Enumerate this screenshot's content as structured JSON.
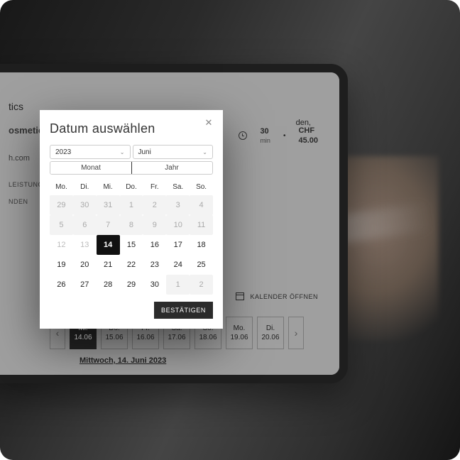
{
  "background": {
    "scene_hint": "haircut-scissors"
  },
  "screen": {
    "brand_suffix": "tics",
    "shop_name": "osmetics",
    "domain_fragment": "h.com",
    "nav": {
      "services": "LEISTUNGSAUS",
      "send": "NDEN"
    },
    "service_suffix": "den,",
    "duration": {
      "value": "30",
      "unit": "min"
    },
    "price": {
      "currency": "CHF",
      "amount": "45.00"
    },
    "calendar_link": "KALENDER ÖFFNEN",
    "strip": {
      "items": [
        {
          "dow": "Mi.",
          "date": "14.06",
          "active": true
        },
        {
          "dow": "Do.",
          "date": "15.06",
          "active": false
        },
        {
          "dow": "Fr.",
          "date": "16.06",
          "active": false
        },
        {
          "dow": "Sa.",
          "date": "17.06",
          "active": false
        },
        {
          "dow": "So.",
          "date": "18.06",
          "active": false
        },
        {
          "dow": "Mo.",
          "date": "19.06",
          "active": false
        },
        {
          "dow": "Di.",
          "date": "20.06",
          "active": false
        }
      ]
    },
    "selected_date_long": "Mittwoch, 14. Juni 2023"
  },
  "modal": {
    "title": "Datum auswählen",
    "year": "2023",
    "month": "Juni",
    "toggle": {
      "month": "Monat",
      "year": "Jahr",
      "active": "month"
    },
    "weekdays": [
      "Mo.",
      "Di.",
      "Mi.",
      "Do.",
      "Fr.",
      "Sa.",
      "So."
    ],
    "rows": [
      {
        "cells": [
          "29",
          "30",
          "31",
          "1",
          "2",
          "3",
          "4"
        ],
        "muted_until": 3,
        "all_disabled": true
      },
      {
        "cells": [
          "5",
          "6",
          "7",
          "8",
          "9",
          "10",
          "11"
        ],
        "all_disabled": true
      },
      {
        "cells": [
          "12",
          "13",
          "14",
          "15",
          "16",
          "17",
          "18"
        ],
        "past_until": 2,
        "selected_index": 2
      },
      {
        "cells": [
          "19",
          "20",
          "21",
          "22",
          "23",
          "24",
          "25"
        ]
      },
      {
        "cells": [
          "26",
          "27",
          "28",
          "29",
          "30",
          "1",
          "2"
        ],
        "muted_from": 5
      }
    ],
    "confirm": "BESTÄTIGEN"
  }
}
